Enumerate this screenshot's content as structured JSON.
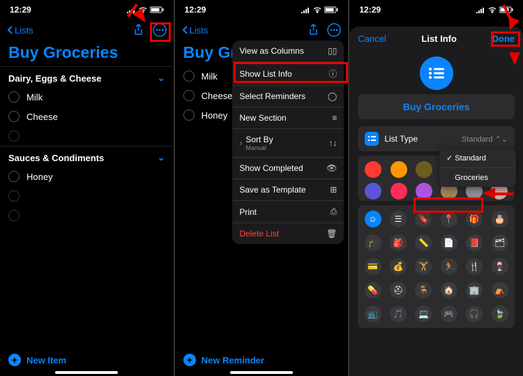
{
  "status": {
    "time": "12:29"
  },
  "panel1": {
    "back": "Lists",
    "title": "Buy Groceries",
    "section1": "Dairy, Eggs & Cheese",
    "items1": [
      "Milk",
      "Cheese"
    ],
    "section2": "Sauces & Condiments",
    "items2": [
      "Honey"
    ],
    "add": "New Item"
  },
  "panel2": {
    "back": "Lists",
    "title": "Buy Gro",
    "items": [
      "Milk",
      "Cheese",
      "Honey"
    ],
    "menu": {
      "view_columns": "View as Columns",
      "show_info": "Show List Info",
      "select": "Select Reminders",
      "new_section": "New Section",
      "sort_by": "Sort By",
      "sort_val": "Manual",
      "show_completed": "Show Completed",
      "save_template": "Save as Template",
      "print": "Print",
      "delete": "Delete List"
    },
    "add": "New Reminder"
  },
  "panel3": {
    "cancel": "Cancel",
    "title": "List Info",
    "done": "Done",
    "name": "Buy Groceries",
    "list_type_label": "List Type",
    "list_type_value": "Standard",
    "dropdown": {
      "opt1": "Standard",
      "opt2": "Groceries"
    },
    "colors": [
      "#ff3b30",
      "#ff9500",
      "#ffcc00",
      "#34c759",
      "#5ac8fa",
      "#007aff",
      "#5856d6",
      "#ff2d55",
      "#af52de",
      "#a2845e",
      "#8e8e93",
      "#c9a8a0"
    ]
  }
}
